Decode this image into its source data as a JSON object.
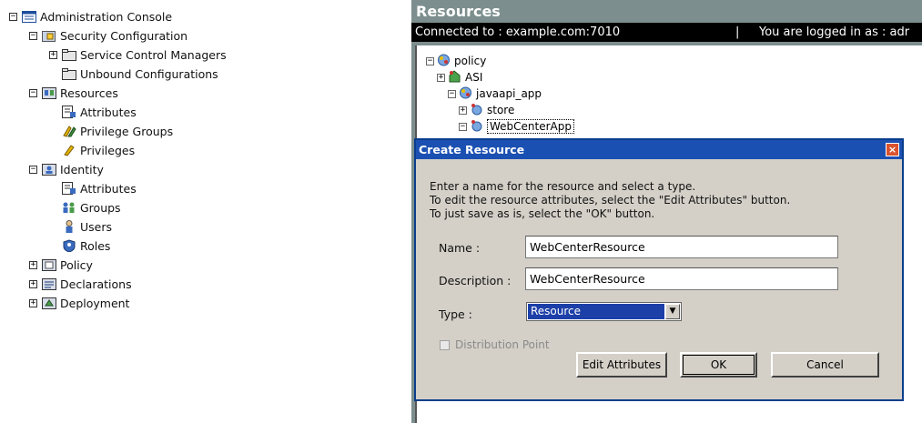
{
  "nav": {
    "items": [
      {
        "label": "Administration Console",
        "expander": "−",
        "icon": "console-icon"
      },
      {
        "label": "Security Configuration",
        "expander": "−",
        "icon": "security-config-icon"
      },
      {
        "label": "Service Control Managers",
        "expander": "+",
        "icon": "folder-icon"
      },
      {
        "label": "Unbound Configurations",
        "expander": "",
        "icon": "folder-icon"
      },
      {
        "label": "Resources",
        "expander": "−",
        "icon": "resources-icon"
      },
      {
        "label": "Attributes",
        "expander": "",
        "icon": "attributes-icon"
      },
      {
        "label": "Privilege Groups",
        "expander": "",
        "icon": "privilege-groups-icon"
      },
      {
        "label": "Privileges",
        "expander": "",
        "icon": "privileges-icon"
      },
      {
        "label": "Identity",
        "expander": "−",
        "icon": "identity-icon"
      },
      {
        "label": "Attributes",
        "expander": "",
        "icon": "attributes-icon"
      },
      {
        "label": "Groups",
        "expander": "",
        "icon": "groups-icon"
      },
      {
        "label": "Users",
        "expander": "",
        "icon": "user-icon"
      },
      {
        "label": "Roles",
        "expander": "",
        "icon": "roles-icon"
      },
      {
        "label": "Policy",
        "expander": "+",
        "icon": "policy-icon"
      },
      {
        "label": "Declarations",
        "expander": "+",
        "icon": "declarations-icon"
      },
      {
        "label": "Deployment",
        "expander": "+",
        "icon": "deployment-icon"
      }
    ]
  },
  "window": {
    "title": "Resources",
    "connected": "Connected to : example.com:7010",
    "separator": "|",
    "logged_in": "You are logged in as : adr"
  },
  "resource_tree": {
    "items": [
      {
        "label": "policy",
        "expander": "−",
        "icon": "policy-node-icon"
      },
      {
        "label": "ASI",
        "expander": "+",
        "icon": "resource-node-icon"
      },
      {
        "label": "javaapi_app",
        "expander": "−",
        "icon": "policy-node-icon"
      },
      {
        "label": "store",
        "expander": "+",
        "icon": "resource-node-icon"
      },
      {
        "label": "WebCenterApp",
        "expander": "−",
        "icon": "resource-node-icon"
      }
    ]
  },
  "dialog": {
    "title": "Create Resource",
    "close": "×",
    "instructions": [
      "Enter a name for the resource and select a type.",
      "To edit the resource attributes, select the \"Edit Attributes\" button.",
      "To just save as is, select the \"OK\" button."
    ],
    "name_label": "Name :",
    "name_value": "WebCenterResource",
    "description_label": "Description :",
    "description_value": "WebCenterResource",
    "type_label": "Type :",
    "type_value": "Resource",
    "type_arrow": "▼",
    "distribution_label": "Distribution Point",
    "edit_attributes_label": "Edit Attributes",
    "ok_label": "OK",
    "cancel_label": "Cancel"
  },
  "colors": {
    "dialog_title_bar": "#1b50b3",
    "window_header": "#7d8e8e",
    "selection": "#1c3fa8"
  }
}
